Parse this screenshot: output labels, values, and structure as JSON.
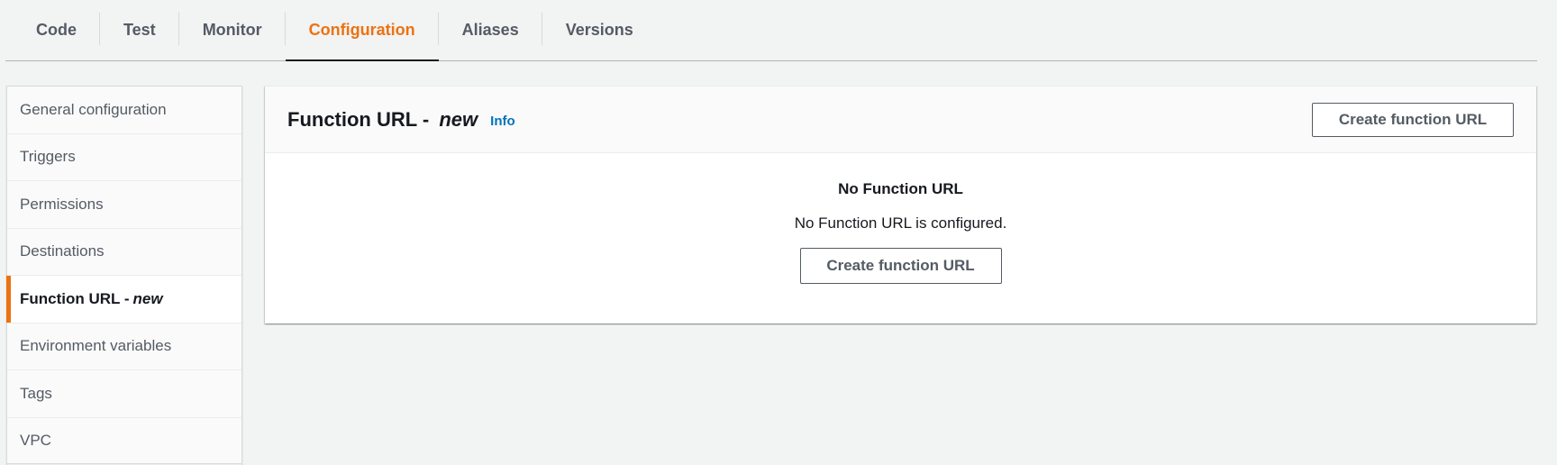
{
  "tabs": [
    {
      "label": "Code",
      "active": false
    },
    {
      "label": "Test",
      "active": false
    },
    {
      "label": "Monitor",
      "active": false
    },
    {
      "label": "Configuration",
      "active": true
    },
    {
      "label": "Aliases",
      "active": false
    },
    {
      "label": "Versions",
      "active": false
    }
  ],
  "sidebar": {
    "items": [
      {
        "label": "General configuration"
      },
      {
        "label": "Triggers"
      },
      {
        "label": "Permissions"
      },
      {
        "label": "Destinations"
      },
      {
        "label": "Function URL -",
        "suffix": "new",
        "active": true
      },
      {
        "label": "Environment variables"
      },
      {
        "label": "Tags"
      },
      {
        "label": "VPC"
      }
    ]
  },
  "panel": {
    "title": "Function URL -",
    "title_suffix": "new",
    "info_label": "Info",
    "header_button_label": "Create function URL",
    "empty": {
      "title": "No Function URL",
      "description": "No Function URL is configured.",
      "button_label": "Create function URL"
    }
  },
  "colors": {
    "accent": "#ec7211",
    "link": "#0073bb",
    "background": "#f2f3f3"
  }
}
